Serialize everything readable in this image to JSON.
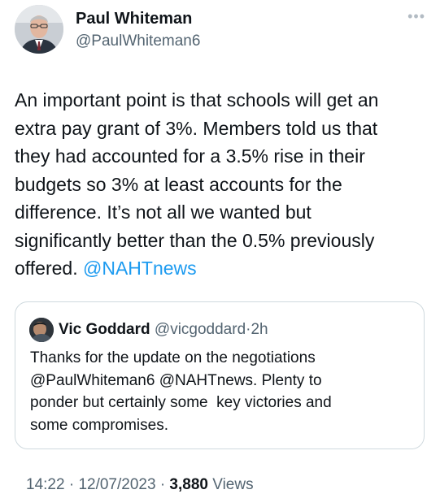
{
  "tweet": {
    "author": {
      "name": "Paul Whiteman",
      "handle": "@PaulWhiteman6"
    },
    "more_icon": "more-dots-icon",
    "lines": [
      "An important point is that schools will get an",
      "extra pay grant of 3%. Members told us that",
      "they had accounted for a 3.5% rise in their",
      "budgets so 3% at least accounts for the",
      "difference. It’s not all we wanted but",
      "significantly better than the 0.5% previously"
    ],
    "last_line_text": "offered. ",
    "last_line_mention": "@NAHTnews"
  },
  "quoted_tweet": {
    "name": "Vic Goddard",
    "handle": "@vicgoddard",
    "separator": "·",
    "time": "2h",
    "lines": [
      "Thanks for the update on the negotiations",
      "@PaulWhiteman6 @NAHTnews. Plenty to",
      "ponder but certainly some  key victories and",
      "some compromises."
    ]
  },
  "meta": {
    "time": "14:22",
    "date": "12/07/2023",
    "separator": "·",
    "views_count": "3,880",
    "views_label": "Views"
  },
  "colors": {
    "link": "#1d9bf0",
    "secondary": "#536471",
    "border": "#cfd9de"
  }
}
